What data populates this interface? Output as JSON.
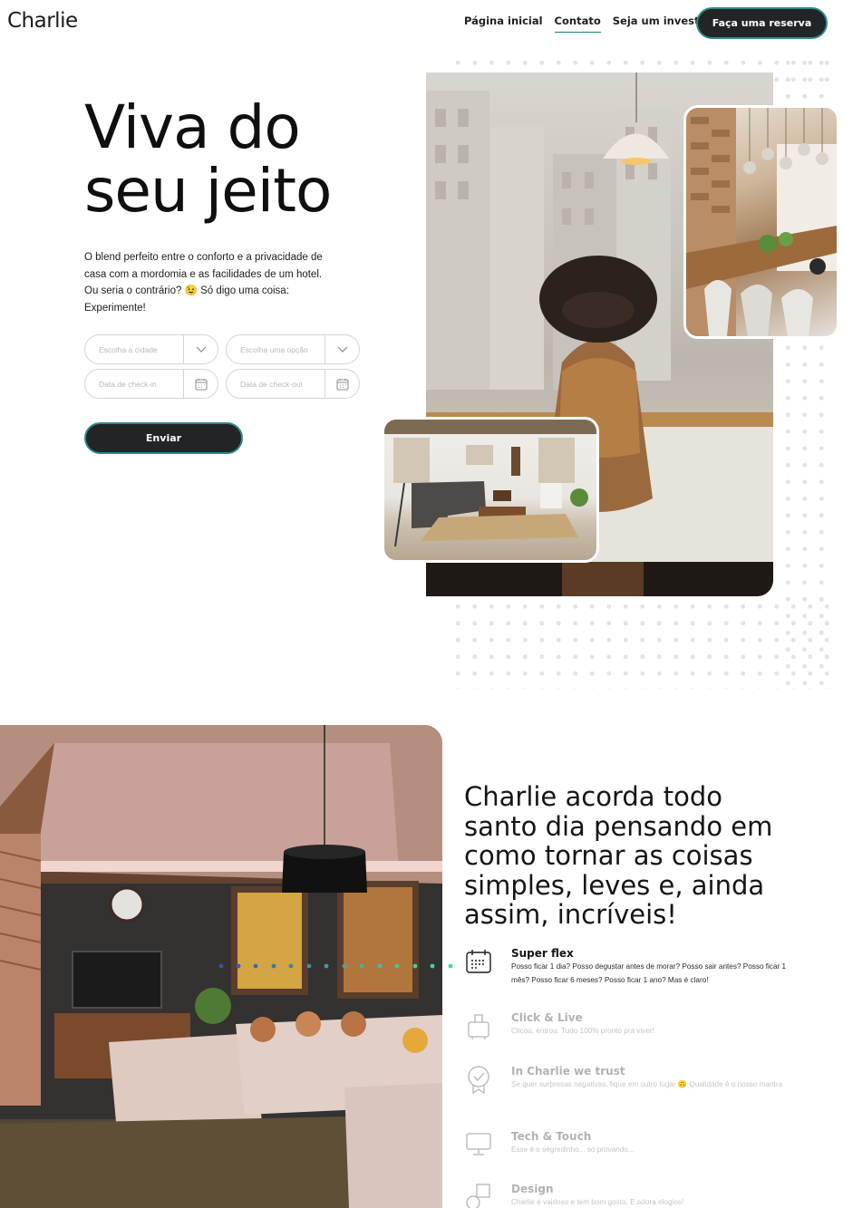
{
  "header": {
    "logo": "Charlie",
    "nav": {
      "home": "Página inicial",
      "contact": "Contato",
      "investor": "Seja um investidor"
    },
    "cta_label": "Faça uma reserva"
  },
  "hero": {
    "title_line1": "Viva do",
    "title_line2": "seu jeito",
    "subtitle_line1": "O blend perfeito entre o conforto e a privacidade de",
    "subtitle_line2": "casa com a mordomia e as facilidades de um hotel.",
    "subtitle_line3": "Ou seria o contrário? 😉 Só digo uma coisa:",
    "subtitle_line4": "Experimente!",
    "form": {
      "city_placeholder": "Escolha a cidade",
      "option_placeholder": "Escolha uma opção",
      "checkin_placeholder": "Data de check-in",
      "checkout_placeholder": "Data de check-out",
      "submit_label": "Enviar"
    }
  },
  "about": {
    "title": "Charlie acorda todo santo dia pensando em como tornar as coisas simples, leves e, ainda assim, incríveis!",
    "features": [
      {
        "title": "Super flex",
        "text": "Posso ficar 1 dia? Posso degustar antes de morar? Posso sair antes? Posso ficar 1 mês? Posso ficar 6 meses? Posso ficar 1 ano? Mas é claro!",
        "icon": "calendar-icon"
      },
      {
        "title": "Click & Live",
        "text": "Clicou, entrou. Tudo 100% pronto pra viver!",
        "icon": "luggage-icon"
      },
      {
        "title": "In Charlie we trust",
        "text": "Se quer surpresas negativas, fique em outro lugar 🙃 Qualidade é o nosso mantra",
        "icon": "badge-icon"
      },
      {
        "title": "Tech & Touch",
        "text": "Esse é o segredinho... só provando...",
        "icon": "monitor-icon"
      },
      {
        "title": "Design",
        "text": "Charlie é vaidoso e tem bom gosto. E adora elogios!",
        "icon": "shapes-icon"
      }
    ]
  },
  "colors": {
    "accent": "#2f8a88",
    "dark_button": "#222426"
  }
}
